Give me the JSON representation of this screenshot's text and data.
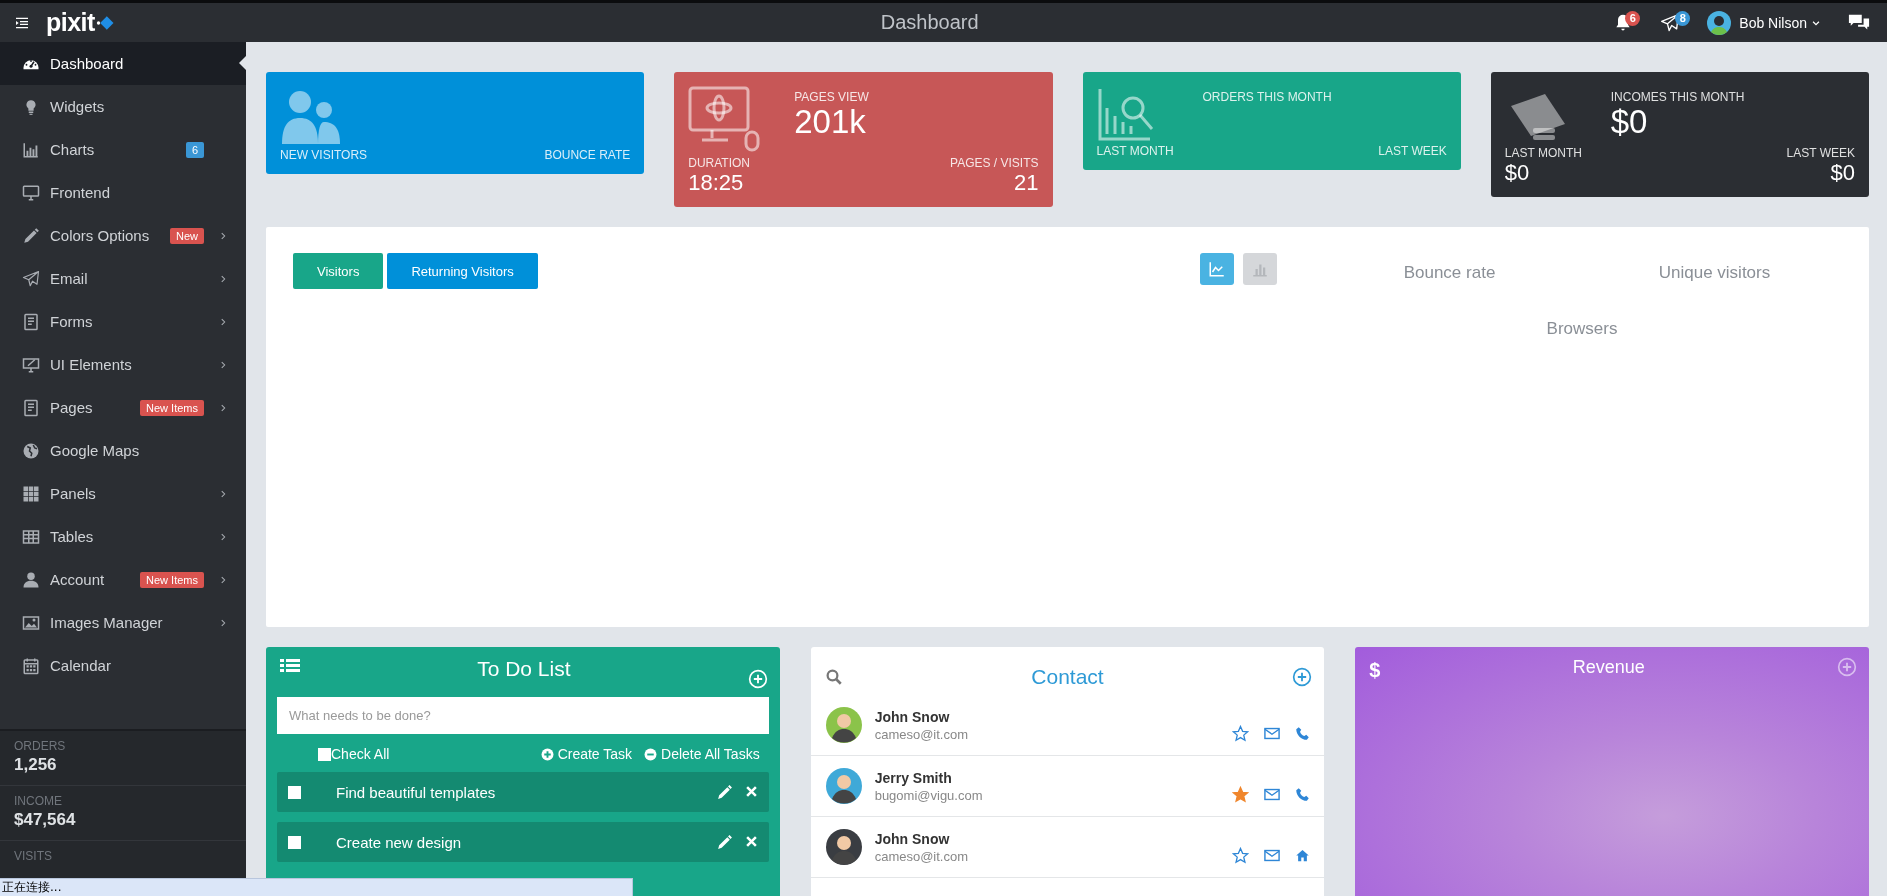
{
  "topbar": {
    "logo": "pixit",
    "title": "Dashboard",
    "notifications": {
      "count": "6"
    },
    "messages": {
      "count": "8"
    },
    "user": {
      "name": "Bob Nilson"
    }
  },
  "sidebar": {
    "items": [
      {
        "label": "Dashboard",
        "selected": true,
        "submenu": false
      },
      {
        "label": "Widgets",
        "selected": false,
        "submenu": false
      },
      {
        "label": "Charts",
        "selected": false,
        "submenu": false,
        "badge": {
          "text": "6",
          "color": "#3a97d6"
        }
      },
      {
        "label": "Frontend",
        "selected": false,
        "submenu": false
      },
      {
        "label": "Colors Options",
        "selected": false,
        "submenu": true,
        "badge": {
          "text": "New",
          "color": "#d9534f"
        }
      },
      {
        "label": "Email",
        "selected": false,
        "submenu": true
      },
      {
        "label": "Forms",
        "selected": false,
        "submenu": true
      },
      {
        "label": "UI Elements",
        "selected": false,
        "submenu": true
      },
      {
        "label": "Pages",
        "selected": false,
        "submenu": true,
        "badge": {
          "text": "New Items",
          "color": "#d9534f"
        }
      },
      {
        "label": "Google Maps",
        "selected": false,
        "submenu": false
      },
      {
        "label": "Panels",
        "selected": false,
        "submenu": true
      },
      {
        "label": "Tables",
        "selected": false,
        "submenu": true
      },
      {
        "label": "Account",
        "selected": false,
        "submenu": true,
        "badge": {
          "text": "New Items",
          "color": "#d9534f"
        }
      },
      {
        "label": "Images Manager",
        "selected": false,
        "submenu": true
      },
      {
        "label": "Calendar",
        "selected": false,
        "submenu": false
      }
    ],
    "stats": [
      {
        "label": "ORDERS",
        "value": "1,256"
      },
      {
        "label": "INCOME",
        "value": "$47,564"
      },
      {
        "label": "VISITS"
      }
    ]
  },
  "cards": [
    {
      "color": "#0090d9",
      "footer": [
        {
          "label": "NEW VISITORS"
        },
        {
          "label": "BOUNCE RATE"
        }
      ]
    },
    {
      "color": "#c75757",
      "title": "PAGES VIEW",
      "value": "201k",
      "footer": [
        {
          "label": "DURATION",
          "value": "18:25"
        },
        {
          "label": "PAGES / VISITS",
          "value": "21"
        }
      ]
    },
    {
      "color": "#18a689",
      "title": "ORDERS THIS MONTH",
      "footer": [
        {
          "label": "LAST MONTH"
        },
        {
          "label": "LAST WEEK"
        }
      ]
    },
    {
      "color": "#2b2e33",
      "title": "INCOMES THIS MONTH",
      "value": "$0",
      "footer": [
        {
          "label": "LAST MONTH",
          "value": "$0"
        },
        {
          "label": "LAST WEEK",
          "value": "$0"
        }
      ]
    }
  ],
  "chart_panel": {
    "buttons": [
      {
        "label": "Visitors",
        "color": "#18a689"
      },
      {
        "label": "Returning Visitors",
        "color": "#0090d9"
      }
    ],
    "views": [
      {
        "selected": true
      },
      {
        "selected": false
      }
    ],
    "metrics": [
      "Bounce rate",
      "Unique visitors",
      "Browsers"
    ]
  },
  "todo": {
    "title": "To Do List",
    "placeholder": "What needs to be done?",
    "check_all": {
      "label": "Check All",
      "checked": false
    },
    "actions": [
      "Create Task",
      "Delete All Tasks"
    ],
    "items": [
      {
        "text": "Find beautiful templates",
        "checked": false
      },
      {
        "text": "Create new design",
        "checked": false
      }
    ]
  },
  "contact": {
    "title": "Contact",
    "contacts": [
      {
        "name": "John Snow",
        "email": "cameso@it.com",
        "color": "#8bc34a",
        "starred": false,
        "kind": "phone"
      },
      {
        "name": "Jerry Smith",
        "email": "bugomi@vigu.com",
        "color": "#3fa9d8",
        "starred": true,
        "kind": "phone"
      },
      {
        "name": "John Snow",
        "email": "cameso@it.com",
        "color": "#3a3d42",
        "starred": false,
        "kind": "home"
      }
    ]
  },
  "revenue": {
    "symbol": "$",
    "title": "Revenue"
  },
  "status_bar": {
    "text": "正在连接..."
  }
}
